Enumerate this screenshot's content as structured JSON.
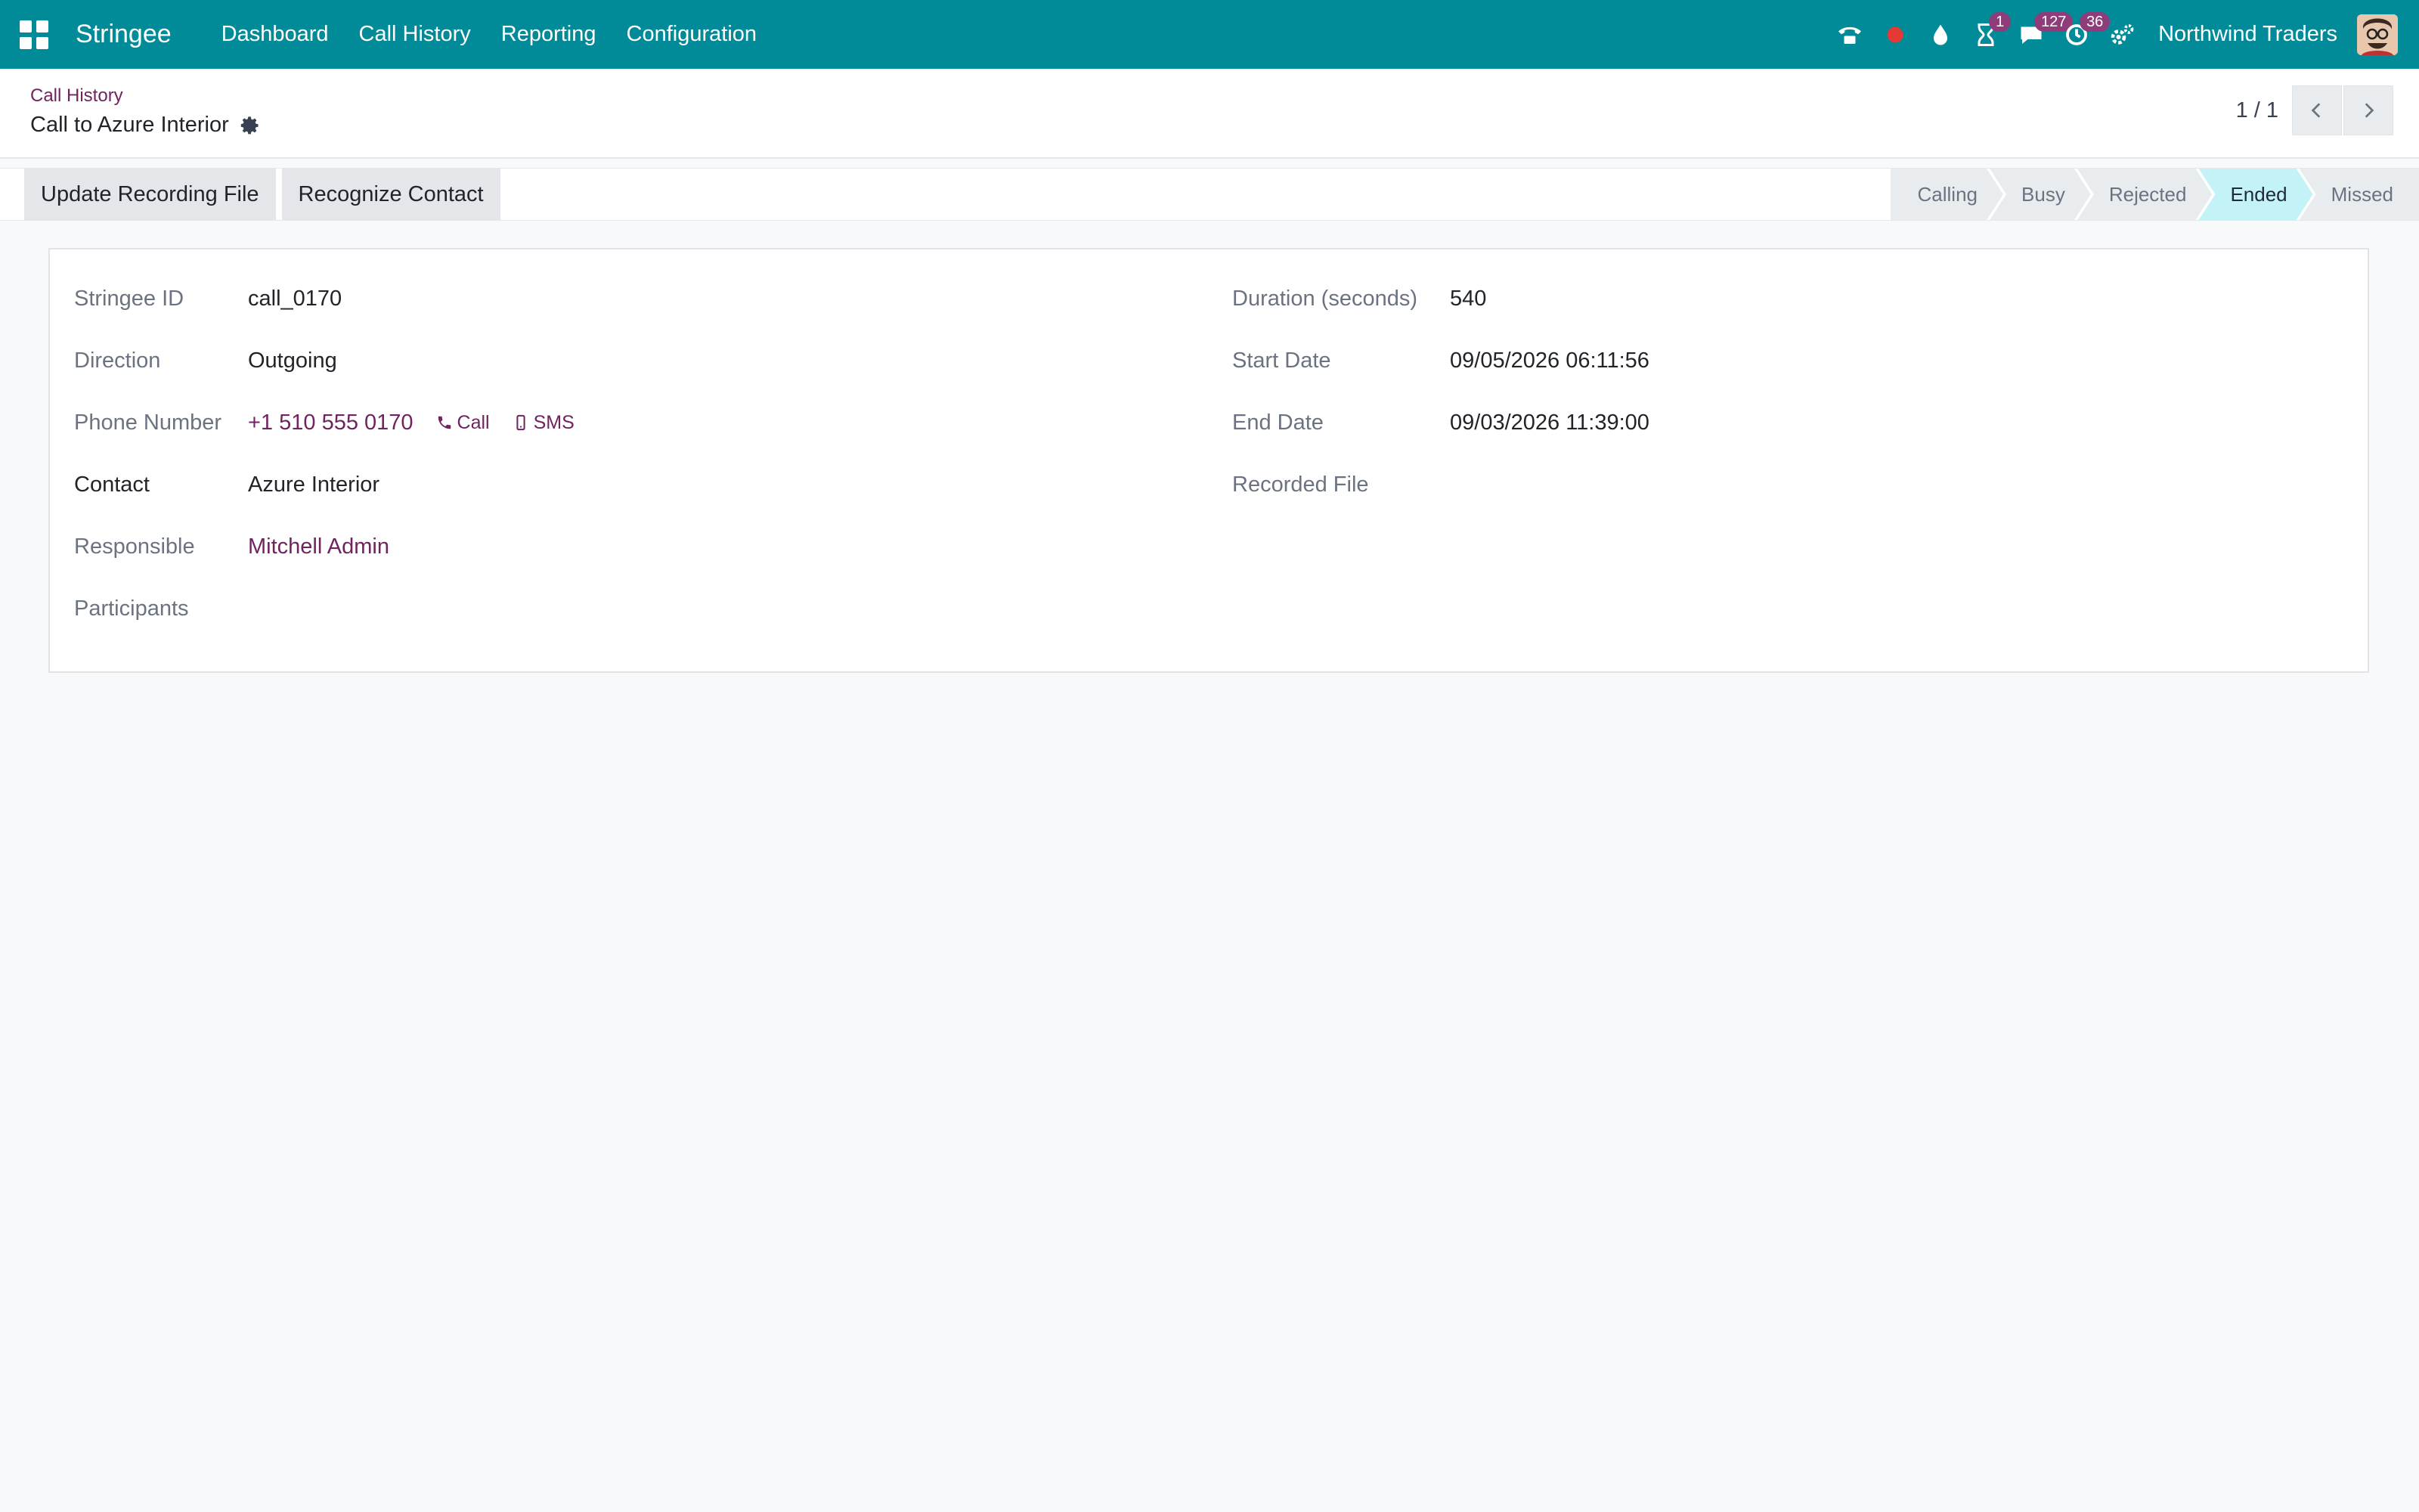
{
  "navbar": {
    "brand": "Stringee",
    "menu": [
      {
        "label": "Dashboard"
      },
      {
        "label": "Call History"
      },
      {
        "label": "Reporting"
      },
      {
        "label": "Configuration"
      }
    ],
    "badges": {
      "activity": "1",
      "messages": "127",
      "clock": "36"
    },
    "company": "Northwind Traders",
    "colors": {
      "bar": "#018a98",
      "badge": "#8f3c7a",
      "record_dot": "#e53935"
    }
  },
  "control": {
    "breadcrumb": "Call History",
    "title": "Call to Azure Interior",
    "pager": "1 / 1"
  },
  "actions": {
    "update_recording": "Update Recording File",
    "recognize_contact": "Recognize Contact"
  },
  "stages": [
    {
      "label": "Calling"
    },
    {
      "label": "Busy"
    },
    {
      "label": "Rejected"
    },
    {
      "label": "Ended",
      "active": true
    },
    {
      "label": "Missed"
    }
  ],
  "form": {
    "left": {
      "stringee_id": {
        "label": "Stringee ID",
        "value": "call_0170"
      },
      "direction": {
        "label": "Direction",
        "value": "Outgoing"
      },
      "phone": {
        "label": "Phone Number",
        "value": "+1 510 555 0170",
        "call": "Call",
        "sms": "SMS"
      },
      "contact": {
        "label": "Contact",
        "value": "Azure Interior"
      },
      "responsible": {
        "label": "Responsible",
        "value": "Mitchell Admin"
      },
      "participants": {
        "label": "Participants"
      }
    },
    "right": {
      "duration": {
        "label": "Duration (seconds)",
        "value": "540"
      },
      "start_date": {
        "label": "Start Date",
        "value": "09/05/2026 06:11:56"
      },
      "end_date": {
        "label": "End Date",
        "value": "09/03/2026 11:39:00"
      },
      "recorded_file": {
        "label": "Recorded File"
      }
    }
  }
}
